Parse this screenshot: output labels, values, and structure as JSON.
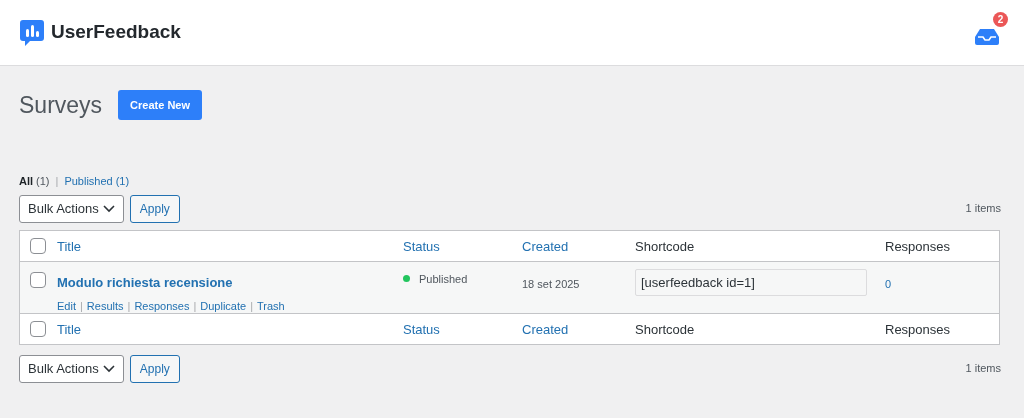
{
  "header": {
    "brand": "UserFeedback",
    "notification_count": "2"
  },
  "page": {
    "title": "Surveys",
    "create_button": "Create New"
  },
  "separator": "|",
  "header_checked": false,
  "footer_checked": false,
  "filters": [
    {
      "label": "All",
      "count": "(1)",
      "selected": true
    },
    {
      "label": "Published",
      "count": "(1)",
      "selected": false
    }
  ],
  "bulk_top": {
    "select": "Bulk Actions",
    "apply": "Apply",
    "count": "1 items"
  },
  "columns": [
    {
      "label": "Title",
      "sortable": true
    },
    {
      "label": "Status",
      "sortable": true
    },
    {
      "label": "Created",
      "sortable": true
    },
    {
      "label": "Shortcode",
      "sortable": false
    },
    {
      "label": "Responses",
      "sortable": false
    }
  ],
  "rows": [
    {
      "checked": false,
      "title": "Modulo richiesta recensione",
      "actions": [
        "Edit",
        "Results",
        "Responses",
        "Duplicate",
        "Trash"
      ],
      "status": "Published",
      "color": "#22c55e",
      "created": "18 set 2025",
      "shortcode": "[userfeedback id=1]",
      "responses": "0"
    }
  ],
  "footer_columns": [
    {
      "label": "Title",
      "sortable": true
    },
    {
      "label": "Status",
      "sortable": true
    },
    {
      "label": "Created",
      "sortable": true
    },
    {
      "label": "Shortcode",
      "sortable": false
    },
    {
      "label": "Responses",
      "sortable": false
    }
  ],
  "bulk_bottom": {
    "select": "Bulk Actions",
    "apply": "Apply",
    "count": "1 items"
  }
}
